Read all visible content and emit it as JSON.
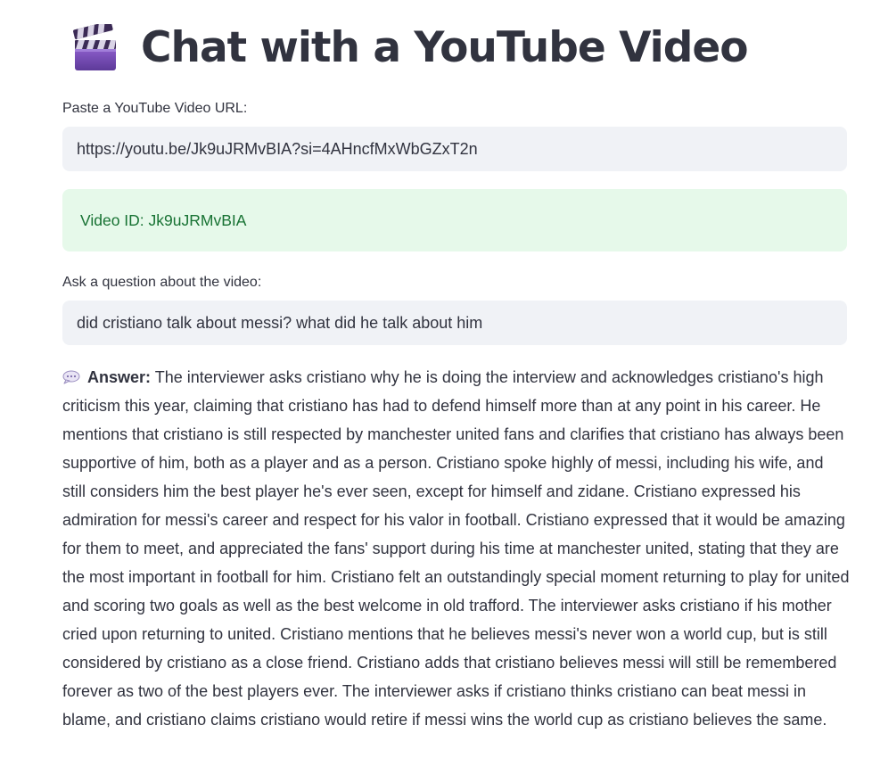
{
  "header": {
    "title": "Chat with a YouTube Video",
    "icon": "clapper-board-icon"
  },
  "url_input": {
    "label": "Paste a YouTube Video URL:",
    "value": "https://youtu.be/Jk9uJRMvBIA?si=4AHncfMxWbGZxT2n"
  },
  "status": {
    "video_id_text": "Video ID: Jk9uJRMvBIA",
    "color": "#177233",
    "background": "#e6f9ea"
  },
  "question_input": {
    "label": "Ask a question about the video:",
    "value": "did cristiano talk about messi? what did he talk about him"
  },
  "answer": {
    "icon": "speech-bubble-icon",
    "label": "Answer:",
    "text": "The interviewer asks cristiano why he is doing the interview and acknowledges cristiano's high criticism this year, claiming that cristiano has had to defend himself more than at any point in his career. He mentions that cristiano is still respected by manchester united fans and clarifies that cristiano has always been supportive of him, both as a player and as a person. Cristiano spoke highly of messi, including his wife, and still considers him the best player he's ever seen, except for himself and zidane. Cristiano expressed his admiration for messi's career and respect for his valor in football. Cristiano expressed that it would be amazing for them to meet, and appreciated the fans' support during his time at manchester united, stating that they are the most important in football for him. Cristiano felt an outstandingly special moment returning to play for united and scoring two goals as well as the best welcome in old trafford. The interviewer asks cristiano if his mother cried upon returning to united. Cristiano mentions that he believes messi's never won a world cup, but is still considered by cristiano as a close friend. Cristiano adds that cristiano believes messi will still be remembered forever as two of the best players ever. The interviewer asks if cristiano thinks cristiano can beat messi in blame, and cristiano claims cristiano would retire if messi wins the world cup as cristiano believes the same."
  }
}
